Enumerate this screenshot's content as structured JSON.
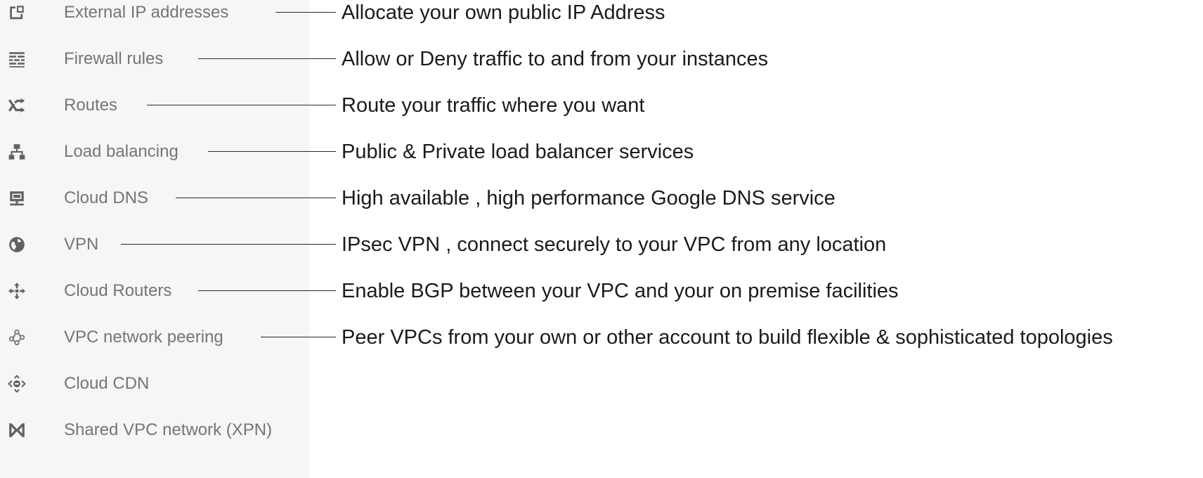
{
  "colors": {
    "sidebar_background": "#f6f6f6",
    "nav_label": "#757575",
    "nav_icon": "#616161",
    "description_text": "#1b1b1b",
    "connector_line": "#2a2a2a"
  },
  "nav_items": [
    {
      "label": "External IP addresses",
      "icon": "external-ip-icon",
      "description": "Allocate your own public IP Address"
    },
    {
      "label": "Firewall rules",
      "icon": "firewall-icon",
      "description": "Allow or Deny traffic to and from your instances"
    },
    {
      "label": "Routes",
      "icon": "routes-icon",
      "description": "Route your traffic where you want"
    },
    {
      "label": "Load balancing",
      "icon": "load-balancing-icon",
      "description": "Public & Private load balancer services"
    },
    {
      "label": "Cloud DNS",
      "icon": "cloud-dns-icon",
      "description": "High available , high performance Google DNS service"
    },
    {
      "label": "VPN",
      "icon": "vpn-globe-icon",
      "description": "IPsec VPN , connect securely to your VPC from any location"
    },
    {
      "label": "Cloud Routers",
      "icon": "cloud-router-icon",
      "description": "Enable BGP between your VPC and your on premise facilities"
    },
    {
      "label": "VPC network peering",
      "icon": "vpc-peering-icon",
      "description": "Peer VPCs from your own or other account to build flexible & sophisticated topologies"
    },
    {
      "label": "Cloud CDN",
      "icon": "cloud-cdn-icon"
    },
    {
      "label": "Shared VPC network (XPN)",
      "icon": "shared-vpc-icon"
    }
  ]
}
